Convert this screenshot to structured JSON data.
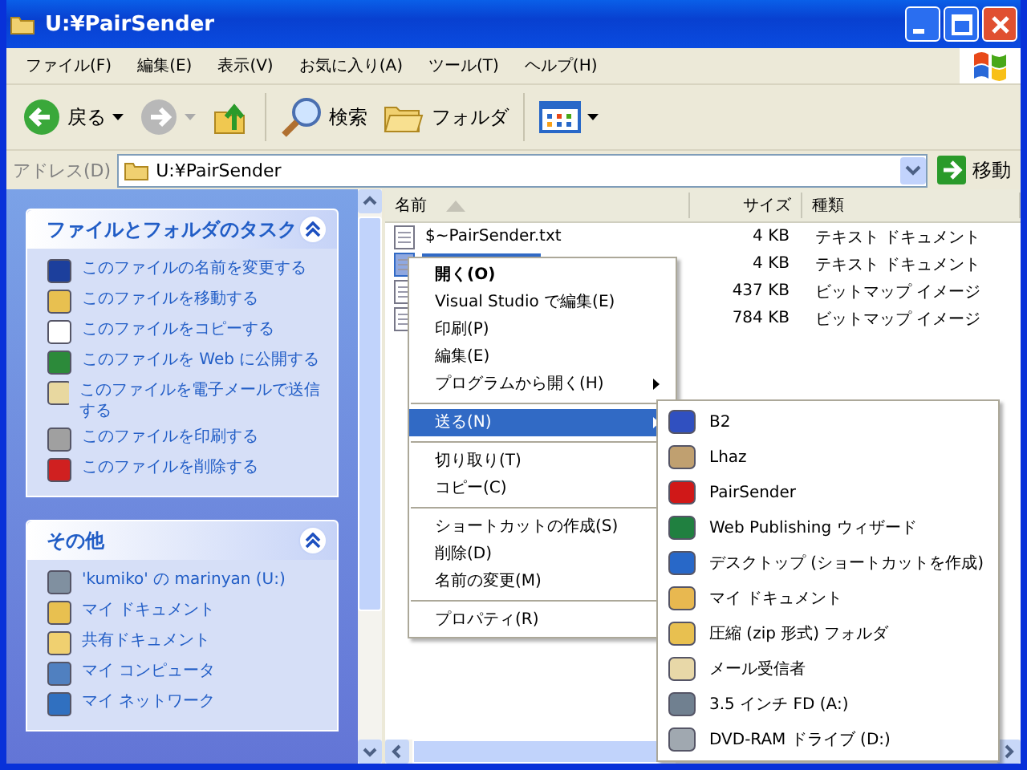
{
  "window": {
    "title": "U:¥PairSender"
  },
  "menu_bar": [
    "ファイル(F)",
    "編集(E)",
    "表示(V)",
    "お気に入り(A)",
    "ツール(T)",
    "ヘルプ(H)"
  ],
  "toolbar": {
    "back": "戻る",
    "search": "検索",
    "folders": "フォルダ"
  },
  "address_bar": {
    "label": "アドレス(D)",
    "value": "U:¥PairSender",
    "go": "移動"
  },
  "task_panels": [
    {
      "title": "ファイルとフォルダのタスク",
      "expanded": true,
      "items": [
        "このファイルの名前を変更する",
        "このファイルを移動する",
        "このファイルをコピーする",
        "このファイルを Web に公開する",
        "このファイルを電子メールで送信する",
        "このファイルを印刷する",
        "このファイルを削除する"
      ]
    },
    {
      "title": "その他",
      "expanded": true,
      "items": [
        "'kumiko' の marinyan (U:)",
        "マイ ドキュメント",
        "共有ドキュメント",
        "マイ コンピュータ",
        "マイ ネットワーク"
      ]
    }
  ],
  "file_list": {
    "columns": [
      "名前",
      "サイズ",
      "種類"
    ],
    "rows": [
      {
        "name": "$~PairSender.txt",
        "size": "4 KB",
        "type": "テキスト ドキュメント",
        "selected": false
      },
      {
        "size": "4 KB",
        "type": "テキスト ドキュメント",
        "selected": true
      },
      {
        "size": "437 KB",
        "type": "ビットマップ イメージ",
        "selected": false
      },
      {
        "size": "784 KB",
        "type": "ビットマップ イメージ",
        "selected": false
      }
    ]
  },
  "context_menu": [
    {
      "kind": "item",
      "label": "開く(O)",
      "default": true,
      "submenu": false,
      "selected": false
    },
    {
      "kind": "item",
      "label": "Visual Studio で編集(E)",
      "default": false,
      "submenu": false,
      "selected": false
    },
    {
      "kind": "item",
      "label": "印刷(P)",
      "default": false,
      "submenu": false,
      "selected": false
    },
    {
      "kind": "item",
      "label": "編集(E)",
      "default": false,
      "submenu": false,
      "selected": false
    },
    {
      "kind": "item",
      "label": "プログラムから開く(H)",
      "default": false,
      "submenu": true,
      "selected": false
    },
    {
      "kind": "separator"
    },
    {
      "kind": "item",
      "label": "送る(N)",
      "default": false,
      "submenu": true,
      "selected": true
    },
    {
      "kind": "separator"
    },
    {
      "kind": "item",
      "label": "切り取り(T)",
      "default": false,
      "submenu": false,
      "selected": false
    },
    {
      "kind": "item",
      "label": "コピー(C)",
      "default": false,
      "submenu": false,
      "selected": false
    },
    {
      "kind": "separator"
    },
    {
      "kind": "item",
      "label": "ショートカットの作成(S)",
      "default": false,
      "submenu": false,
      "selected": false
    },
    {
      "kind": "item",
      "label": "削除(D)",
      "default": false,
      "submenu": false,
      "selected": false
    },
    {
      "kind": "item",
      "label": "名前の変更(M)",
      "default": false,
      "submenu": false,
      "selected": false
    },
    {
      "kind": "separator"
    },
    {
      "kind": "item",
      "label": "プロパティ(R)",
      "default": false,
      "submenu": false,
      "selected": false
    }
  ],
  "send_to_menu": [
    "B2",
    "Lhaz",
    "PairSender",
    "Web Publishing ウィザード",
    "デスクトップ (ショートカットを作成)",
    "マイ ドキュメント",
    "圧縮 (zip 形式) フォルダ",
    "メール受信者",
    "3.5 インチ FD (A:)",
    "DVD-RAM ドライブ (D:)"
  ]
}
